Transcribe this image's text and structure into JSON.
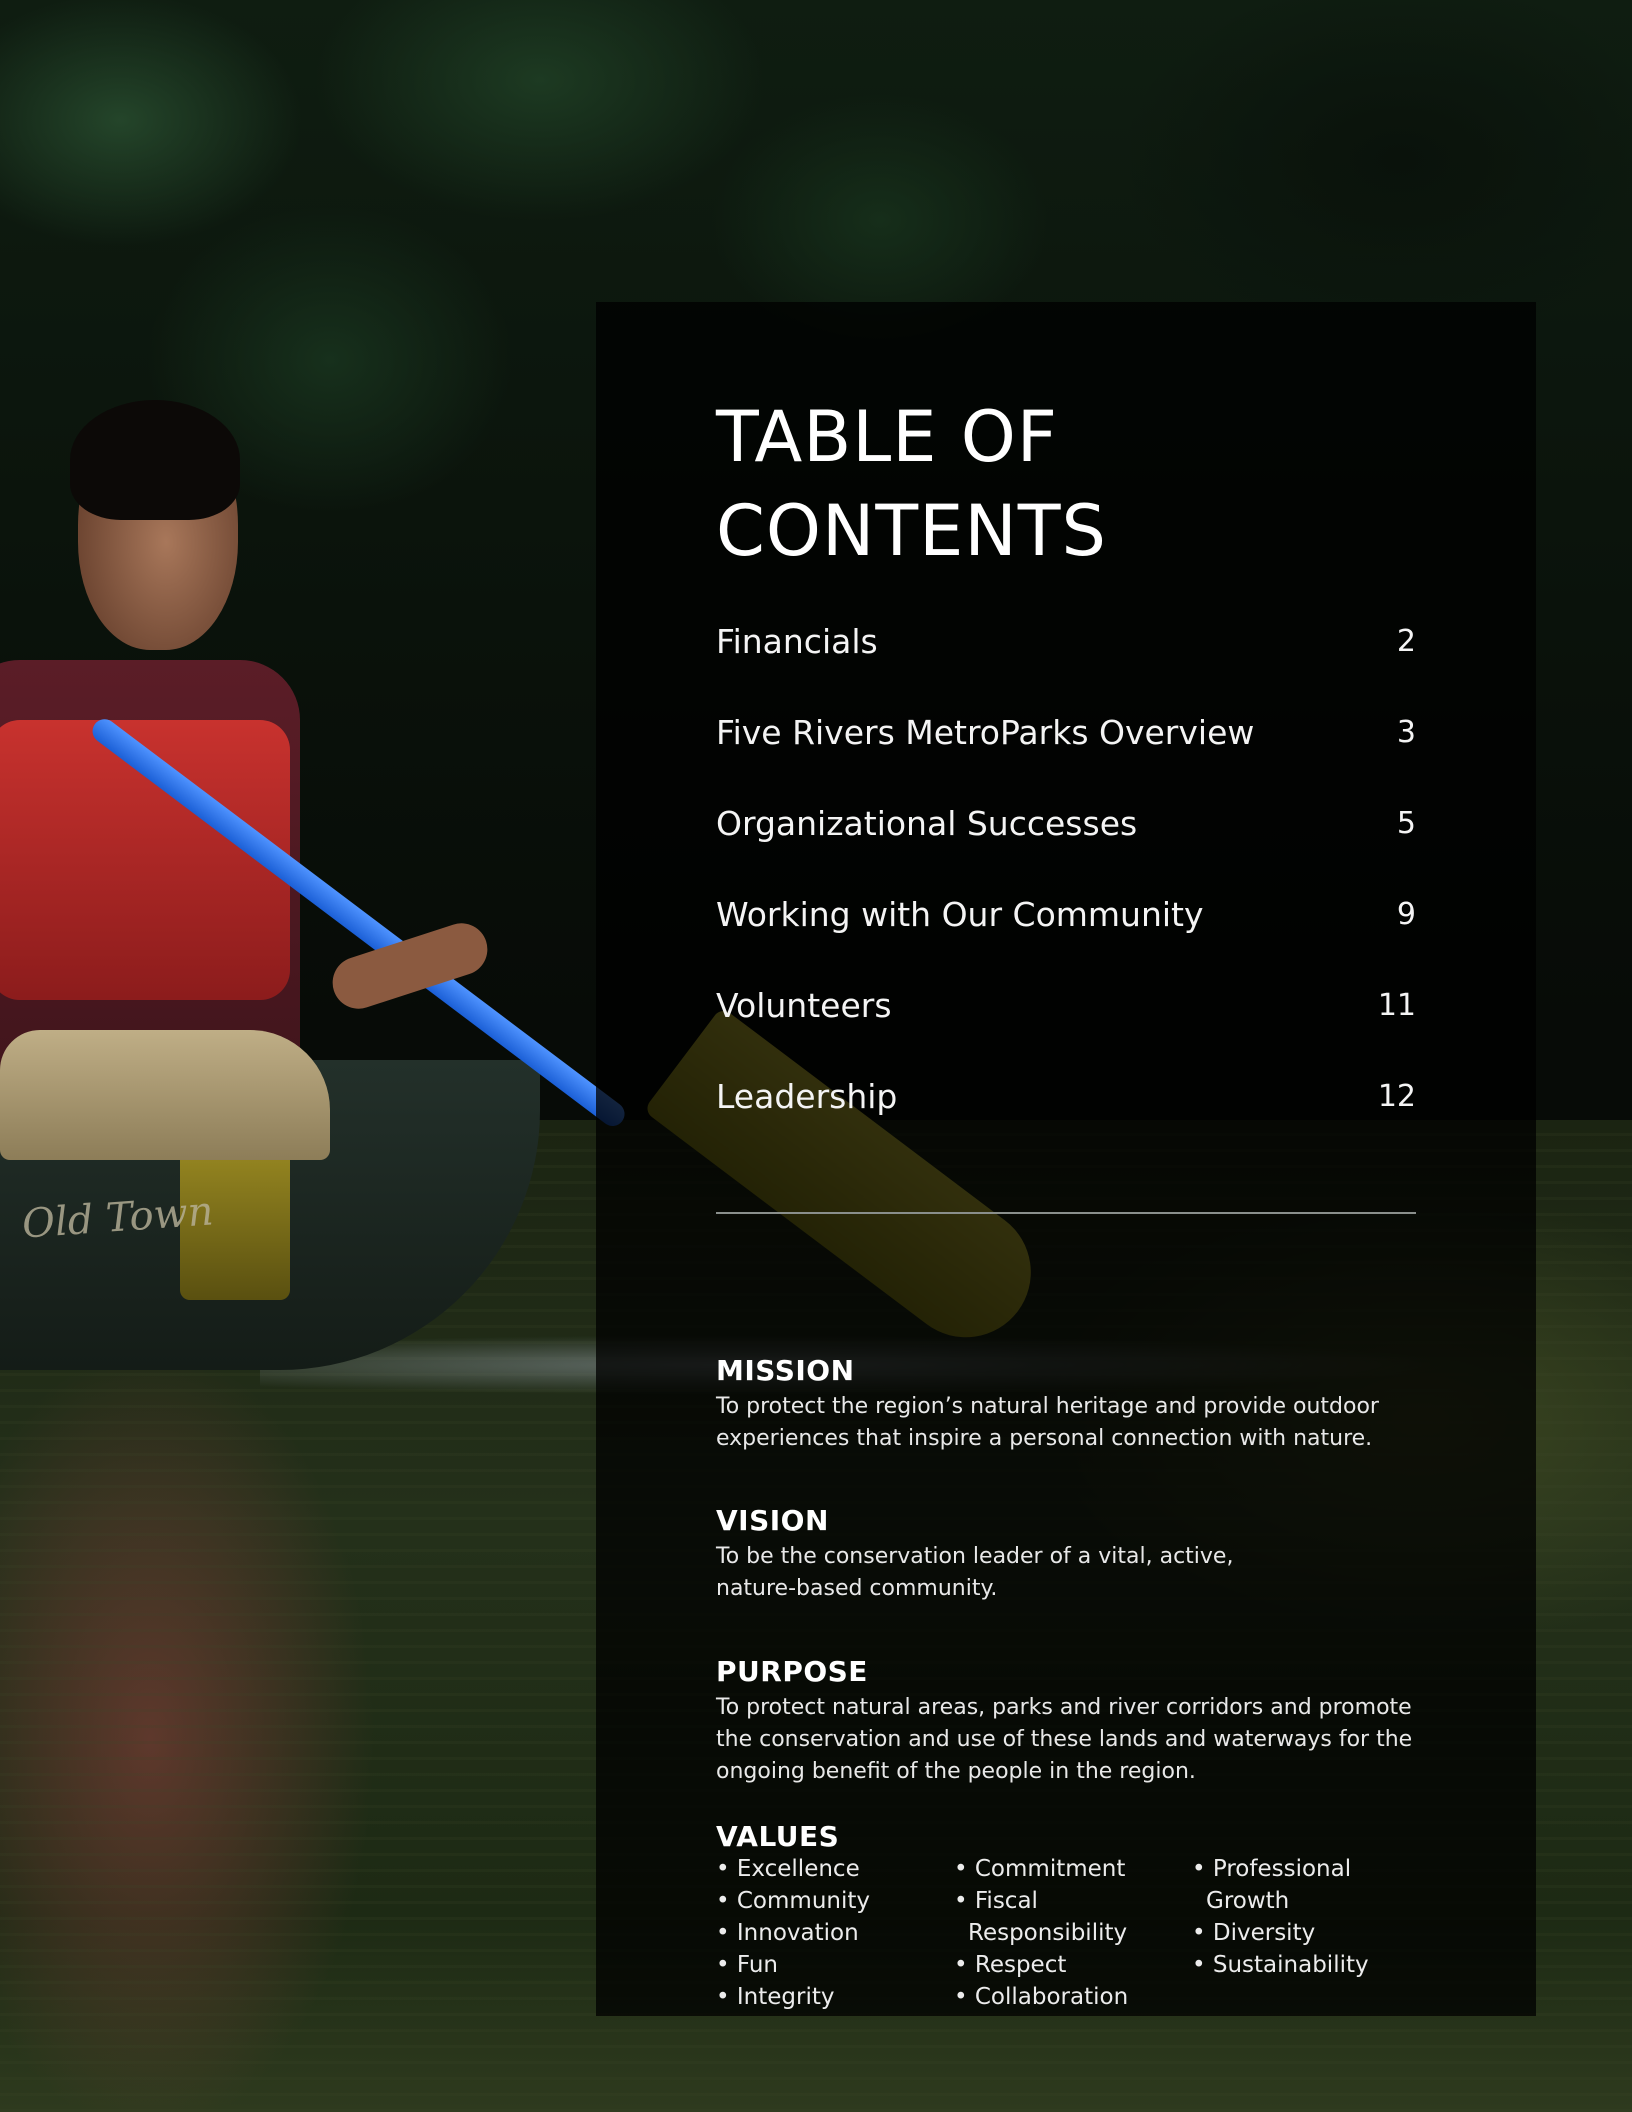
{
  "toc": {
    "title": "TABLE OF\nCONTENTS",
    "items": [
      {
        "label": "Financials",
        "page": "2"
      },
      {
        "label": "Five Rivers MetroParks Overview",
        "page": "3"
      },
      {
        "label": "Organizational Successes",
        "page": "5"
      },
      {
        "label": "Working with Our Community",
        "page": "9"
      },
      {
        "label": "Volunteers",
        "page": "11"
      },
      {
        "label": "Leadership",
        "page": "12"
      }
    ]
  },
  "photo": {
    "canoe_text": "Old Town"
  },
  "mission": {
    "heading": "MISSION",
    "text": "To protect the region’s natural heritage and provide outdoor experiences that inspire a personal connection with nature."
  },
  "vision": {
    "heading": "VISION",
    "text": "To be the conservation leader of a vital, active, nature-based community."
  },
  "purpose": {
    "heading": "PURPOSE",
    "text": "To protect natural areas, parks and river corridors and promote the conservation and use of these lands and waterways for the ongoing benefit of the people in the region."
  },
  "values": {
    "heading": "VALUES",
    "columns": [
      [
        "• Excellence",
        "• Community",
        "• Innovation",
        "• Fun",
        "• Integrity"
      ],
      [
        "• Commitment",
        "• Fiscal Responsibility",
        "• Respect",
        "• Collaboration"
      ],
      [
        "• Professional Growth",
        "• Diversity",
        "• Sustainability"
      ]
    ]
  }
}
